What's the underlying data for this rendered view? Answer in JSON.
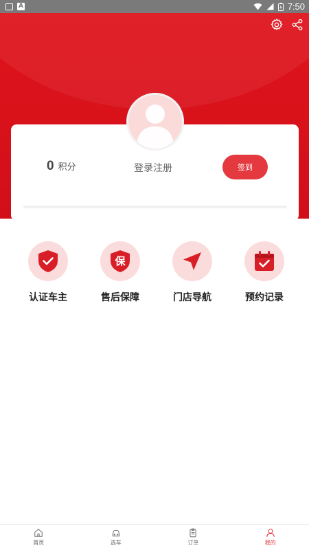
{
  "status_bar": {
    "time": "7:50"
  },
  "header": {
    "settings_icon": "gear-icon",
    "share_icon": "share-icon"
  },
  "profile": {
    "points_value": "0",
    "points_label": "积分",
    "login_label": "登录注册",
    "signin_label": "签到"
  },
  "features": [
    {
      "label": "认证车主",
      "icon": "shield-check-icon"
    },
    {
      "label": "售后保障",
      "icon": "warranty-shield-icon",
      "badge_text": "保"
    },
    {
      "label": "门店导航",
      "icon": "navigation-arrow-icon"
    },
    {
      "label": "预约记录",
      "icon": "calendar-check-icon"
    }
  ],
  "bottom_nav": [
    {
      "label": "首页",
      "icon": "home-icon"
    },
    {
      "label": "选车",
      "icon": "car-icon"
    },
    {
      "label": "订单",
      "icon": "clipboard-icon"
    },
    {
      "label": "我的",
      "icon": "user-icon",
      "active": true
    }
  ],
  "colors": {
    "brand_red": "#e3393f",
    "header_red": "#e8151d",
    "icon_bg": "#fbdcdc"
  }
}
